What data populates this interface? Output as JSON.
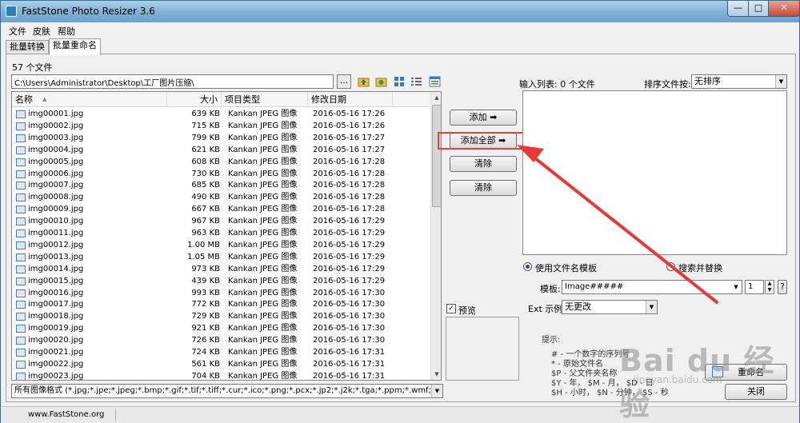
{
  "window": {
    "title": "FastStone Photo Resizer 3.6",
    "minimize": "—",
    "maximize": "□",
    "close": "✕"
  },
  "menu": [
    "文件",
    "皮肤",
    "帮助"
  ],
  "tabs": [
    "批量转换",
    "批量重命名"
  ],
  "left": {
    "file_count": "57 个文件",
    "path": "C:\\Users\\Administrator\\Desktop\\工厂图片压缩\\",
    "browse": "...",
    "columns": [
      "名称",
      "大小",
      "项目类型",
      "修改日期"
    ],
    "files": [
      [
        "img00001.jpg",
        "639 KB",
        "Kankan JPEG 图像",
        "2016-05-16 17:26"
      ],
      [
        "img00002.jpg",
        "715 KB",
        "Kankan JPEG 图像",
        "2016-05-16 17:26"
      ],
      [
        "img00003.jpg",
        "799 KB",
        "Kankan JPEG 图像",
        "2016-05-16 17:27"
      ],
      [
        "img00004.jpg",
        "621 KB",
        "Kankan JPEG 图像",
        "2016-05-16 17:27"
      ],
      [
        "img00005.jpg",
        "608 KB",
        "Kankan JPEG 图像",
        "2016-05-16 17:28"
      ],
      [
        "img00006.jpg",
        "730 KB",
        "Kankan JPEG 图像",
        "2016-05-16 17:28"
      ],
      [
        "img00007.jpg",
        "685 KB",
        "Kankan JPEG 图像",
        "2016-05-16 17:28"
      ],
      [
        "img00008.jpg",
        "490 KB",
        "Kankan JPEG 图像",
        "2016-05-16 17:28"
      ],
      [
        "img00009.jpg",
        "667 KB",
        "Kankan JPEG 图像",
        "2016-05-16 17:28"
      ],
      [
        "img00010.jpg",
        "967 KB",
        "Kankan JPEG 图像",
        "2016-05-16 17:29"
      ],
      [
        "img00011.jpg",
        "963 KB",
        "Kankan JPEG 图像",
        "2016-05-16 17:29"
      ],
      [
        "img00012.jpg",
        "1.00 MB",
        "Kankan JPEG 图像",
        "2016-05-16 17:29"
      ],
      [
        "img00013.jpg",
        "1.05 MB",
        "Kankan JPEG 图像",
        "2016-05-16 17:29"
      ],
      [
        "img00014.jpg",
        "973 KB",
        "Kankan JPEG 图像",
        "2016-05-16 17:29"
      ],
      [
        "img00015.jpg",
        "439 KB",
        "Kankan JPEG 图像",
        "2016-05-16 17:29"
      ],
      [
        "img00016.jpg",
        "993 KB",
        "Kankan JPEG 图像",
        "2016-05-16 17:30"
      ],
      [
        "img00017.jpg",
        "772 KB",
        "Kankan JPEG 图像",
        "2016-05-16 17:30"
      ],
      [
        "img00018.jpg",
        "729 KB",
        "Kankan JPEG 图像",
        "2016-05-16 17:30"
      ],
      [
        "img00019.jpg",
        "921 KB",
        "Kankan JPEG 图像",
        "2016-05-16 17:30"
      ],
      [
        "img00020.jpg",
        "726 KB",
        "Kankan JPEG 图像",
        "2016-05-16 17:30"
      ],
      [
        "img00021.jpg",
        "724 KB",
        "Kankan JPEG 图像",
        "2016-05-16 17:31"
      ],
      [
        "img00022.jpg",
        "561 KB",
        "Kankan JPEG 图像",
        "2016-05-16 17:31"
      ],
      [
        "img00023.jpg",
        "704 KB",
        "Kankan JPEG 图像",
        "2016-05-16 17:31"
      ]
    ],
    "filter": "所有图像格式 (*.jpg;*.jpe;*.jpeg;*.bmp;*.gif;*.tif;*.tiff;*.cur;*.ico;*.png;*.pcx;*.jp2;*.j2k;*.tga;*.ppm;*.wmf;*.psd;*"
  },
  "middle": {
    "add": "添加 ➡",
    "add_all": "添加全部 ➡",
    "clear": "清除",
    "clear_all": "清除",
    "preview": "预览"
  },
  "right": {
    "input_list_label": "输入列表: 0 个文件",
    "sort_label": "排序文件按:",
    "sort_value": "无排序",
    "use_template": "使用文件名模板",
    "search_replace": "搜索并替换",
    "template_label": "模板:",
    "template_value": "Image#####",
    "start_number": "1",
    "help": "?",
    "ext_label": "Ext 示例:",
    "ext_value": "无更改",
    "hints_title": "提示:",
    "hints": [
      "#  - 一个数字的序列号",
      "*  - 原始文件名",
      "$P - 父文件夹名称",
      "$Y - 年，  $M - 月，  $D - 日",
      "$H - 小时，  $N - 分钟，  $S - 秒"
    ],
    "rename_button": "重命名",
    "close_button": "关闭"
  },
  "status": {
    "site": "www.FastStone.org"
  },
  "watermark": {
    "main": "Bai du 经验",
    "sub": "jingyan.baidu.com"
  },
  "colors": {
    "highlight": "#e04141",
    "arrow": "#e53a3a"
  }
}
